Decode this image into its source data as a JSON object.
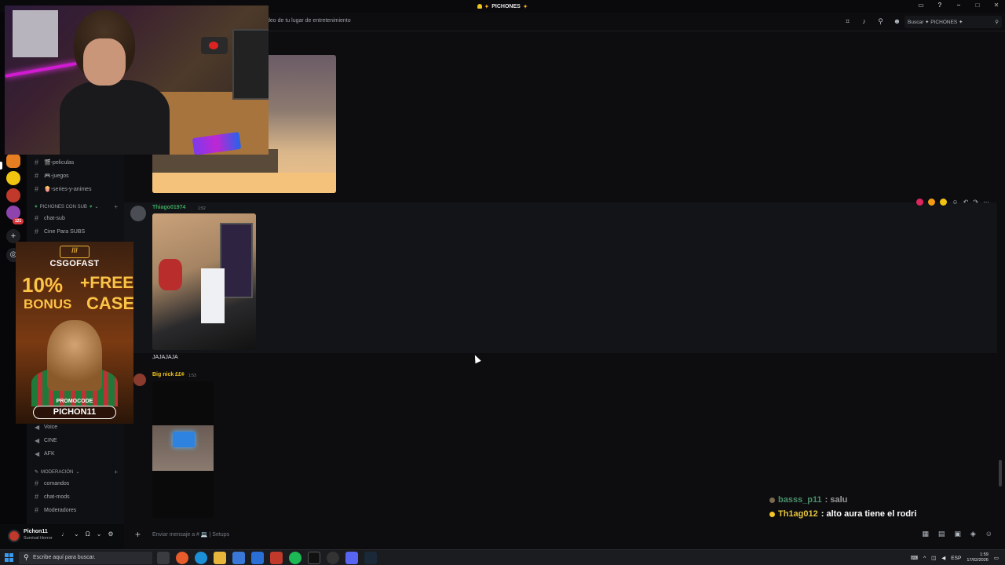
{
  "window": {
    "title": "PICHONES",
    "controls": [
      "inbox-icon",
      "help-icon",
      "minimize-icon",
      "maximize-icon",
      "close-icon"
    ]
  },
  "header": {
    "topic_visible": "deo de tu lugar de entretenimiento",
    "search_placeholder": "Buscar ✦ PICHONES ✦",
    "icons": [
      "threads-icon",
      "mute-icon",
      "pin-icon",
      "members-icon"
    ]
  },
  "sidebar": {
    "top_channels": [
      {
        "label": "🎬-peliculas"
      },
      {
        "label": "🎮-juegos"
      },
      {
        "label": "🍿-series-y-animes"
      }
    ],
    "category_sub": "PICHONES CON SUB",
    "sub_channels": [
      {
        "label": "chat-sub"
      },
      {
        "label": "Cine Para SUBS"
      }
    ],
    "voice_channels": [
      {
        "label": "Voice"
      },
      {
        "label": "CINE"
      },
      {
        "label": "AFK"
      }
    ],
    "category_mod": "MODERACIÓN",
    "mod_channels": [
      {
        "label": "comandos"
      },
      {
        "label": "chat-mods"
      },
      {
        "label": "Moderadores"
      }
    ]
  },
  "user_panel": {
    "name": "Pichon11",
    "status": "Survival Horror"
  },
  "server_rail": {
    "badge_count": "121"
  },
  "ad": {
    "logo": "///",
    "brand": "CSGOFAST",
    "percent": "10%",
    "bonus": "BONUS",
    "free": "+FREE",
    "case": "CASE",
    "promo_label": "PROMOCODE",
    "promo_code": "PICHON11"
  },
  "messages": [
    {
      "author": "Thiago01974",
      "time": "1:52",
      "text": "JAJAJAJA",
      "author_color": "#3ba55d"
    },
    {
      "author": "Big nick ££¢",
      "time": "1:53",
      "text": "",
      "author_color": "#f0c419"
    }
  ],
  "reactions": [
    "heart-red",
    "heart-orange",
    "heart-yellow"
  ],
  "live_chat": [
    {
      "user": "basss_p11",
      "text": ": salu",
      "color": "#4a8f6a"
    },
    {
      "user": "Th1ag012",
      "text": ": alto aura tiene el rodri",
      "color": "#e6c33c"
    }
  ],
  "composer": {
    "placeholder": "Enviar mensaje a # 💻 | Setups"
  },
  "taskbar": {
    "search_placeholder": "Escribe aquí para buscar.",
    "lang": "ESP",
    "time": "1:59",
    "date": "17/02/2026"
  }
}
